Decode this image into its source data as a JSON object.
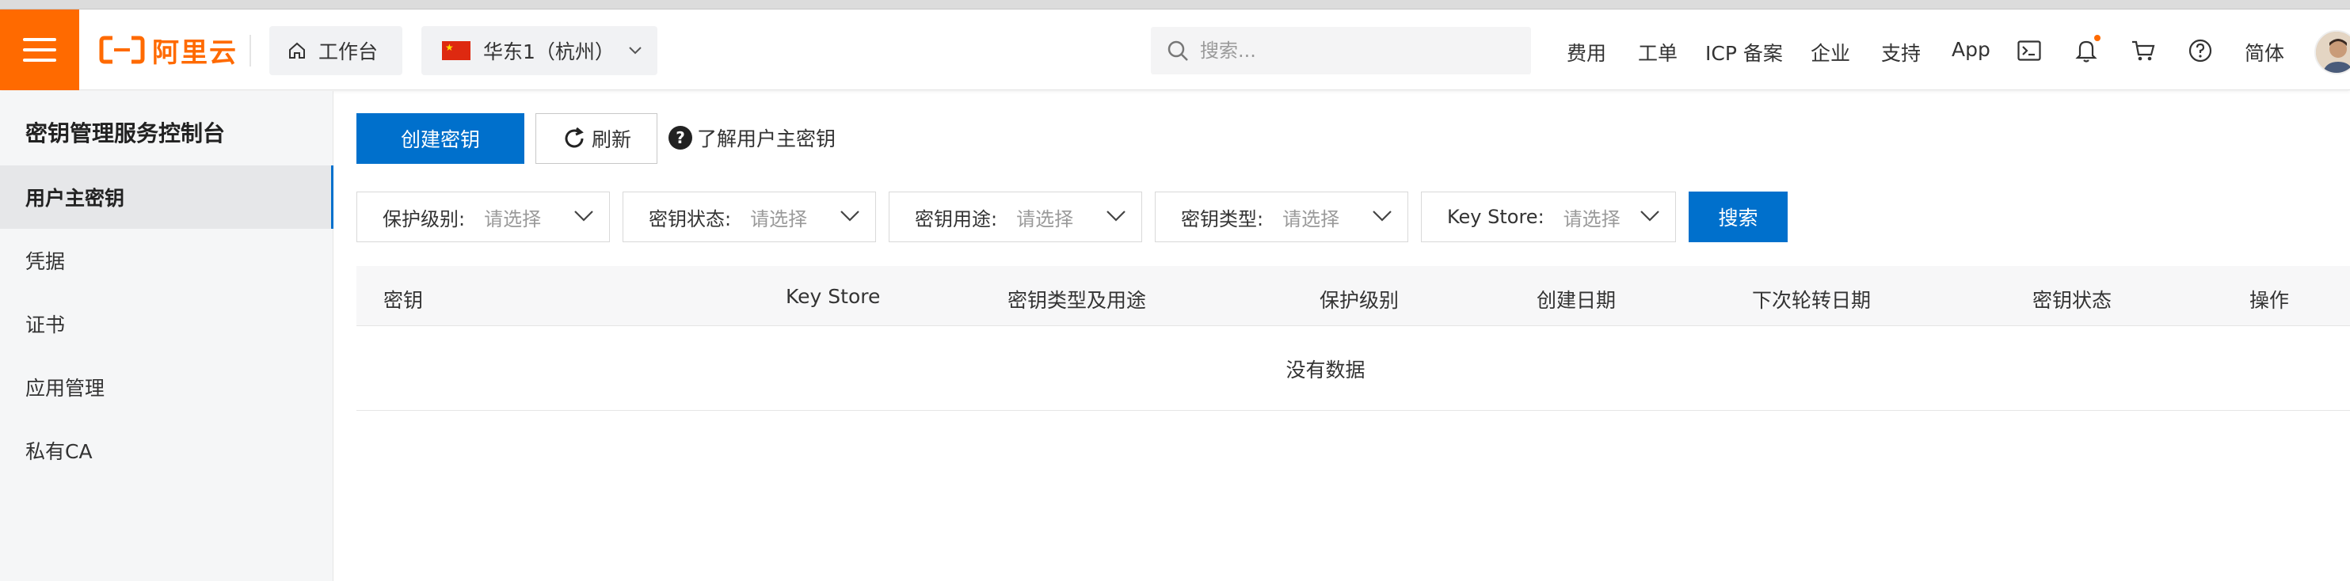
{
  "brand": {
    "logo_text": "阿里云",
    "accent": "#ff6a00",
    "primary": "#0070cc"
  },
  "header": {
    "workbench_label": "工作台",
    "region_label": "华东1（杭州）",
    "search_placeholder": "搜索...",
    "links": [
      "费用",
      "工单",
      "ICP 备案",
      "企业",
      "支持",
      "App"
    ],
    "language": "简体",
    "icons": [
      "terminal-icon",
      "bell-icon",
      "cart-icon",
      "help-icon"
    ]
  },
  "sidebar": {
    "title": "密钥管理服务控制台",
    "items": [
      {
        "label": "用户主密钥",
        "active": true
      },
      {
        "label": "凭据",
        "active": false
      },
      {
        "label": "证书",
        "active": false
      },
      {
        "label": "应用管理",
        "active": false
      },
      {
        "label": "私有CA",
        "active": false
      }
    ]
  },
  "toolbar": {
    "create_label": "创建密钥",
    "refresh_label": "刷新",
    "help_label": "了解用户主密钥"
  },
  "filters": [
    {
      "label": "保护级别:",
      "value": "请选择"
    },
    {
      "label": "密钥状态:",
      "value": "请选择"
    },
    {
      "label": "密钥用途:",
      "value": "请选择"
    },
    {
      "label": "密钥类型:",
      "value": "请选择"
    },
    {
      "label": "Key Store:",
      "value": "请选择"
    }
  ],
  "search_button": "搜索",
  "table": {
    "columns": [
      "密钥",
      "Key Store",
      "密钥类型及用途",
      "保护级别",
      "创建日期",
      "下次轮转日期",
      "密钥状态",
      "操作"
    ],
    "empty_text": "没有数据"
  }
}
